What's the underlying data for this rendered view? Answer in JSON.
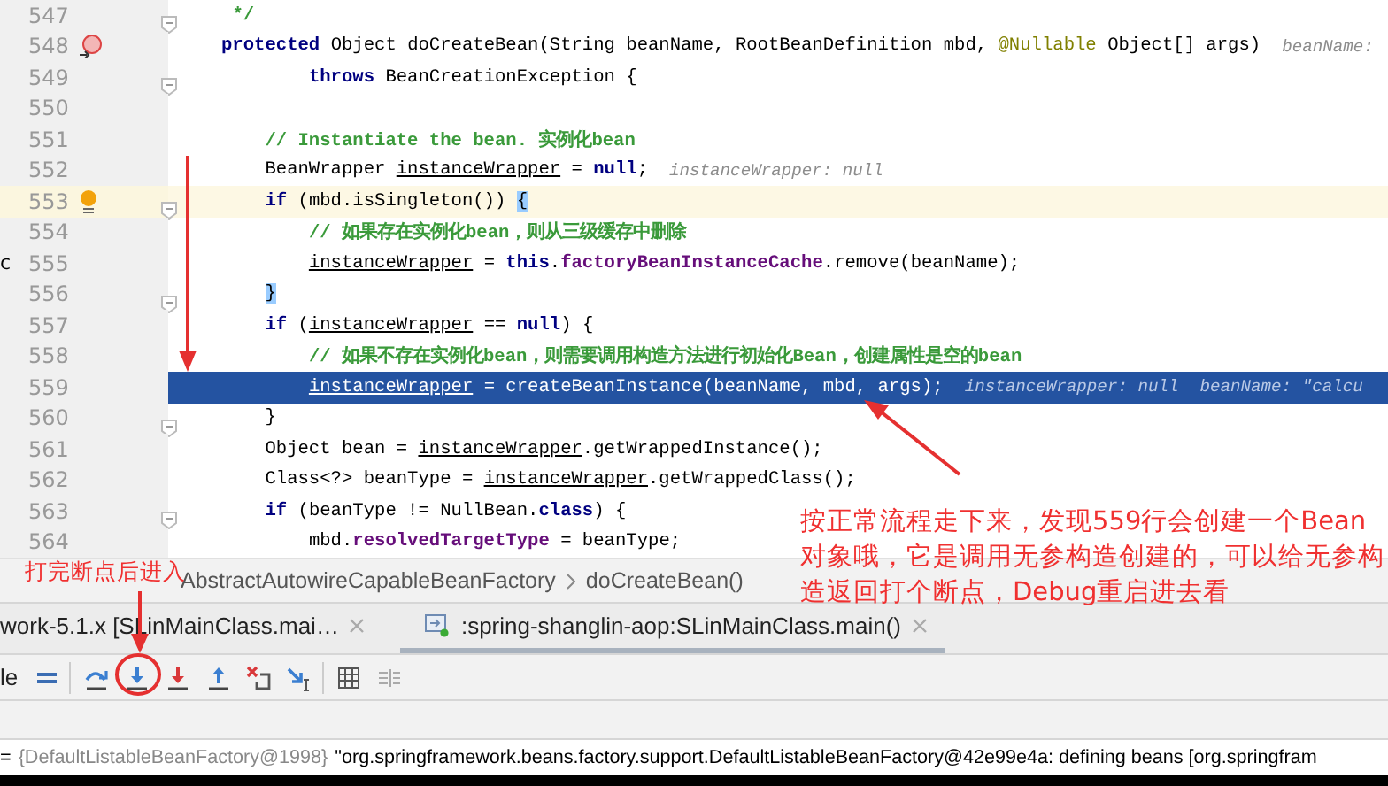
{
  "editor": {
    "lines": [
      {
        "number": "547",
        "current_line": false,
        "execution_point": false,
        "breakpoint": false,
        "bulb": false,
        "fold": true,
        "segments": [
          {
            "kind": "comment",
            "text": " */"
          }
        ]
      },
      {
        "number": "548",
        "current_line": false,
        "execution_point": false,
        "breakpoint": true,
        "bulb": false,
        "fold": false,
        "segments": [
          {
            "kind": "kw",
            "text": "protected"
          },
          {
            "kind": "plain",
            "text": " Object doCreateBean(String beanName, RootBeanDefinition mbd, "
          },
          {
            "kind": "anno",
            "text": "@Nullable"
          },
          {
            "kind": "plain",
            "text": " Object[] args)"
          }
        ],
        "hints": [
          "beanName:"
        ]
      },
      {
        "number": "549",
        "current_line": false,
        "execution_point": false,
        "breakpoint": false,
        "bulb": false,
        "fold": true,
        "segments": [
          {
            "kind": "kw",
            "text": "        throws"
          },
          {
            "kind": "plain",
            "text": " BeanCreationException {"
          }
        ]
      },
      {
        "number": "550",
        "current_line": false,
        "execution_point": false,
        "breakpoint": false,
        "bulb": false,
        "fold": false
      },
      {
        "number": "551",
        "current_line": false,
        "execution_point": false,
        "breakpoint": false,
        "bulb": false,
        "fold": false,
        "segments": [
          {
            "kind": "comment",
            "text": "    // Instantiate the bean. 实例化bean"
          }
        ]
      },
      {
        "number": "552",
        "current_line": false,
        "execution_point": false,
        "breakpoint": false,
        "bulb": false,
        "fold": false,
        "segments": [
          {
            "kind": "plain",
            "text": "    BeanWrapper "
          },
          {
            "kind": "var",
            "text": "instanceWrapper"
          },
          {
            "kind": "plain",
            "text": " = "
          },
          {
            "kind": "kw",
            "text": "null"
          },
          {
            "kind": "plain",
            "text": ";"
          }
        ],
        "hints": [
          "instanceWrapper: null"
        ]
      },
      {
        "number": "553",
        "current_line": true,
        "execution_point": false,
        "breakpoint": false,
        "bulb": true,
        "fold": true,
        "segments": [
          {
            "kind": "kw",
            "text": "    if"
          },
          {
            "kind": "plain",
            "text": " (mbd.isSingleton()) "
          },
          {
            "kind": "brace",
            "text": "{"
          }
        ]
      },
      {
        "number": "554",
        "current_line": false,
        "execution_point": false,
        "breakpoint": false,
        "bulb": false,
        "fold": false,
        "segments": [
          {
            "kind": "comment",
            "text": "        // 如果存在实例化bean，则从三级缓存中删除"
          }
        ]
      },
      {
        "number": "555",
        "current_line": false,
        "execution_point": false,
        "breakpoint": false,
        "bulb": false,
        "fold": false,
        "edge_text": "c",
        "segments": [
          {
            "kind": "var",
            "text": "        instanceWrapper"
          },
          {
            "kind": "plain",
            "text": " = "
          },
          {
            "kind": "kw",
            "text": "this"
          },
          {
            "kind": "plain",
            "text": "."
          },
          {
            "kind": "field",
            "text": "factoryBeanInstanceCache"
          },
          {
            "kind": "plain",
            "text": ".remove(beanName);"
          }
        ]
      },
      {
        "number": "556",
        "current_line": false,
        "execution_point": false,
        "breakpoint": false,
        "bulb": false,
        "fold": true,
        "segments": [
          {
            "kind": "brace",
            "text": "    }"
          }
        ]
      },
      {
        "number": "557",
        "current_line": false,
        "execution_point": false,
        "breakpoint": false,
        "bulb": false,
        "fold": false,
        "segments": [
          {
            "kind": "kw",
            "text": "    if"
          },
          {
            "kind": "plain",
            "text": " ("
          },
          {
            "kind": "var",
            "text": "instanceWrapper"
          },
          {
            "kind": "plain",
            "text": " == "
          },
          {
            "kind": "kw",
            "text": "null"
          },
          {
            "kind": "plain",
            "text": ") {"
          }
        ]
      },
      {
        "number": "558",
        "current_line": false,
        "execution_point": false,
        "breakpoint": false,
        "bulb": false,
        "fold": false,
        "segments": [
          {
            "kind": "comment",
            "text": "        // 如果不存在实例化bean，则需要调用构造方法进行初始化Bean，创建属性是空的bean"
          }
        ]
      },
      {
        "number": "559",
        "current_line": false,
        "execution_point": true,
        "breakpoint": false,
        "bulb": false,
        "fold": false,
        "segments": [
          {
            "kind": "var",
            "text": "        instanceWrapper"
          },
          {
            "kind": "plain",
            "text": " = createBeanInstance(beanName, mbd, args);"
          }
        ],
        "hints": [
          "instanceWrapper: null",
          "beanName: \"calcu"
        ]
      },
      {
        "number": "560",
        "current_line": false,
        "execution_point": false,
        "breakpoint": false,
        "bulb": false,
        "fold": true,
        "segments": [
          {
            "kind": "plain",
            "text": "    }"
          }
        ]
      },
      {
        "number": "561",
        "current_line": false,
        "execution_point": false,
        "breakpoint": false,
        "bulb": false,
        "fold": false,
        "segments": [
          {
            "kind": "plain",
            "text": "    Object bean = "
          },
          {
            "kind": "var",
            "text": "instanceWrapper"
          },
          {
            "kind": "plain",
            "text": ".getWrappedInstance();"
          }
        ]
      },
      {
        "number": "562",
        "current_line": false,
        "execution_point": false,
        "breakpoint": false,
        "bulb": false,
        "fold": false,
        "segments": [
          {
            "kind": "plain",
            "text": "    Class<?> beanType = "
          },
          {
            "kind": "var",
            "text": "instanceWrapper"
          },
          {
            "kind": "plain",
            "text": ".getWrappedClass();"
          }
        ]
      },
      {
        "number": "563",
        "current_line": false,
        "execution_point": false,
        "breakpoint": false,
        "bulb": false,
        "fold": true,
        "segments": [
          {
            "kind": "kw",
            "text": "    if"
          },
          {
            "kind": "plain",
            "text": " (beanType != NullBean."
          },
          {
            "kind": "kw",
            "text": "class"
          },
          {
            "kind": "plain",
            "text": ") {"
          }
        ]
      },
      {
        "number": "564",
        "current_line": false,
        "execution_point": false,
        "breakpoint": false,
        "bulb": false,
        "fold": false,
        "segments": [
          {
            "kind": "plain",
            "text": "        mbd."
          },
          {
            "kind": "field",
            "text": "resolvedTargetType"
          },
          {
            "kind": "plain",
            "text": " = beanType;"
          }
        ]
      }
    ]
  },
  "breadcrumb": [
    "AbstractAutowireCapableBeanFactory",
    "doCreateBean()"
  ],
  "debug_tabs": [
    {
      "label": "work-5.1.x [SLinMainClass.mai…",
      "selected": false
    },
    {
      "label": ":spring-shanglin-aop:SLinMainClass.main()",
      "selected": true
    }
  ],
  "toolbar": {
    "cut_label": "le"
  },
  "variable_line": {
    "prefix": "=",
    "object": "{DefaultListableBeanFactory@1998}",
    "value": "\"org.springframework.beans.factory.support.DefaultListableBeanFactory@42e99e4a: defining beans [org.springfram"
  },
  "annotations": {
    "step_into_note": "打完断点后进入",
    "main_note": "按正常流程走下来，发现559行会创建一个Bean对象哦，它是调用无参构造创建的，可以给无参构造返回打个断点，Debug重启进去看"
  }
}
